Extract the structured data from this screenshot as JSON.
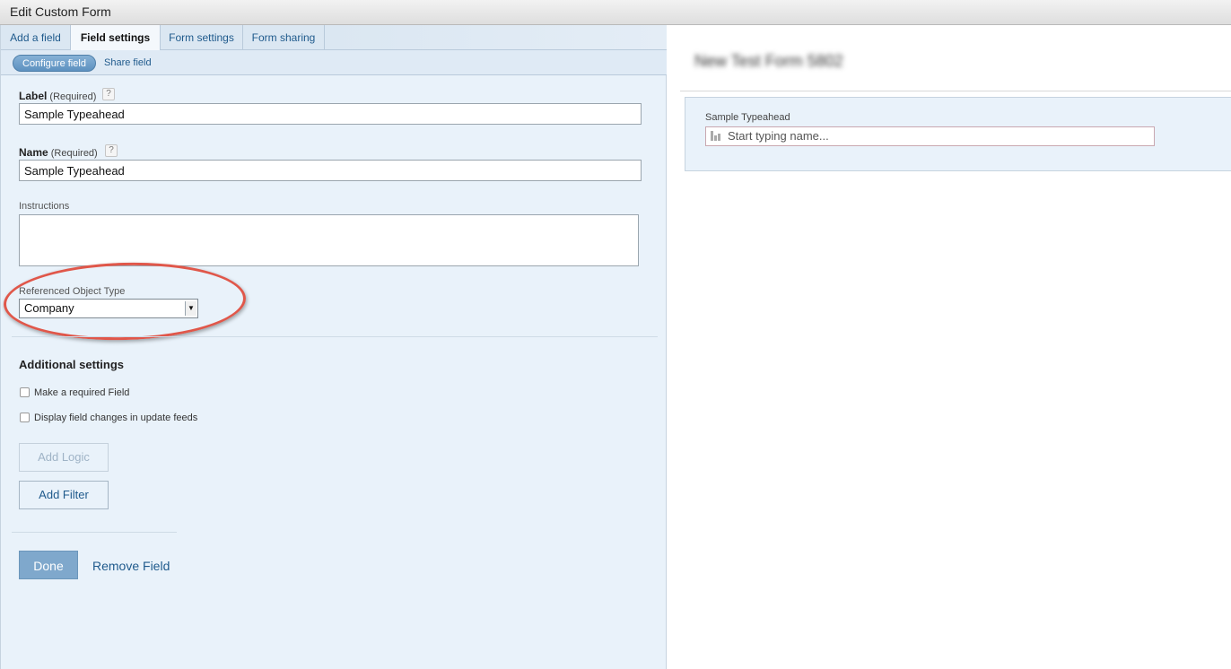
{
  "window": {
    "title": "Edit Custom Form"
  },
  "tabs": [
    {
      "label": "Add a field"
    },
    {
      "label": "Field settings"
    },
    {
      "label": "Form settings"
    },
    {
      "label": "Form sharing"
    }
  ],
  "subtabs": {
    "configure": "Configure field",
    "share": "Share field"
  },
  "fields": {
    "label": {
      "title": "Label",
      "required": "(Required)",
      "help": "?",
      "value": "Sample Typeahead"
    },
    "name": {
      "title": "Name",
      "required": "(Required)",
      "help": "?",
      "value": "Sample Typeahead"
    },
    "instructions": {
      "title": "Instructions",
      "value": ""
    },
    "object_type": {
      "title": "Referenced Object Type",
      "value": "Company",
      "arrow": "▼"
    }
  },
  "additional": {
    "heading": "Additional settings",
    "checks": [
      {
        "label": "Make a required Field",
        "checked": false
      },
      {
        "label": "Display field changes in update feeds",
        "checked": false
      }
    ],
    "add_logic": "Add Logic",
    "add_filter": "Add Filter"
  },
  "footer": {
    "done": "Done",
    "remove": "Remove Field"
  },
  "preview": {
    "form_title": "New Test Form 5802",
    "field_label": "Sample Typeahead",
    "placeholder": "Start typing name..."
  },
  "colors": {
    "accent": "#1f5a8c",
    "panel": "#e9f2fa",
    "highlight": "#e0574a"
  }
}
